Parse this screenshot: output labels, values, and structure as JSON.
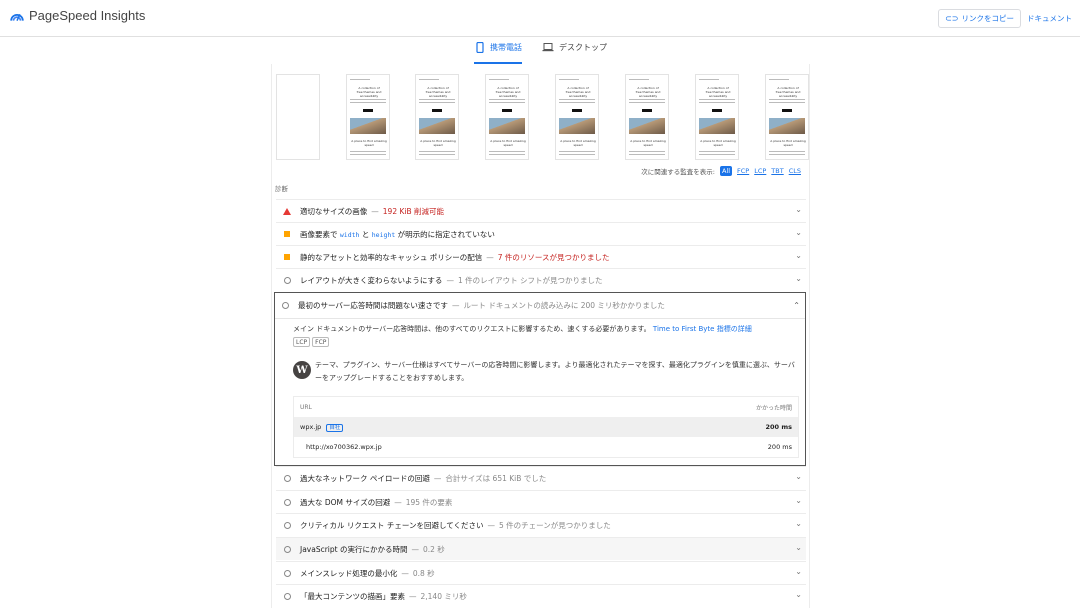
{
  "header": {
    "title": "PageSpeed Insights",
    "copy_link": "リンクをコピー",
    "docs": "ドキュメント"
  },
  "tabs": [
    {
      "label": "携帯電話",
      "active": true
    },
    {
      "label": "デスクトップ",
      "active": false
    }
  ],
  "filmstrip": {
    "thumb_title_1": "A collection of",
    "thumb_title_2": "free themes and",
    "thumb_title_3": "accessibility",
    "thumb_caption_1": "A place to find amazing",
    "thumb_caption_2": "speed"
  },
  "filter": {
    "label": "次に関連する監査を表示:",
    "options": [
      "All",
      "FCP",
      "LCP",
      "TBT",
      "CLS"
    ],
    "selected": "All"
  },
  "section_label": "診断",
  "audits": [
    {
      "status": "fail",
      "title": "適切なサイズの画像",
      "detail": "192 KiB 削減可能",
      "detail_color": "red"
    },
    {
      "status": "average",
      "title_pre": "画像要素で",
      "code1": "width",
      "title_mid": "と",
      "code2": "height",
      "title_post": "が明示的に指定されていない"
    },
    {
      "status": "average",
      "title": "静的なアセットと効率的なキャッシュ ポリシーの配信",
      "detail": "7 件のリソースが見つかりました",
      "detail_color": "red"
    },
    {
      "status": "info",
      "title": "レイアウトが大きく変わらないようにする",
      "detail": "1 件のレイアウト シフトが見つかりました"
    },
    {
      "status": "info",
      "title": "過大なネットワーク ペイロードの回避",
      "detail": "合計サイズは 651 KiB でした"
    },
    {
      "status": "info",
      "title": "過大な DOM サイズの回避",
      "detail": "195 件の要素"
    },
    {
      "status": "info",
      "title": "クリティカル リクエスト チェーンを回避してください",
      "detail": "5 件のチェーンが見つかりました"
    },
    {
      "status": "info",
      "title": "JavaScript の実行にかかる時間",
      "detail": "0.2 秒"
    },
    {
      "status": "info",
      "title": "メインスレッド処理の最小化",
      "detail": "0.8 秒"
    },
    {
      "status": "info",
      "title": "「最大コンテンツの描画」要素",
      "detail": "2,140 ミリ秒"
    }
  ],
  "expanded_audit": {
    "title": "最初のサーバー応答時間は問題ない速さです",
    "detail": "ルート ドキュメントの読み込みに 200 ミリ秒かかりました",
    "description": "メイン ドキュメントのサーバー応答時間は、他のすべてのリクエストに影響するため、速くする必要があります。",
    "learn_more": "Time to First Byte 指標の詳細",
    "tags": [
      "LCP",
      "FCP"
    ],
    "wp_tip": "テーマ、プラグイン、サーバー仕様はすべてサーバーの応答時間に影響します。より最適化されたテーマを探す、最適化プラグインを慎重に選ぶ、サーバーをアップグレードすることをおすすめします。",
    "table": {
      "col_url": "URL",
      "col_time": "かかった時間",
      "group_entity": "wpx.jp",
      "group_badge": "自社",
      "group_time": "200 ms",
      "row_url": "http://xo700362.wpx.jp",
      "row_time": "200 ms"
    }
  },
  "colors": {
    "accent": "#1a73e8",
    "fail": "#e53935",
    "average": "#ffa400",
    "detail_red": "#c5221f"
  }
}
